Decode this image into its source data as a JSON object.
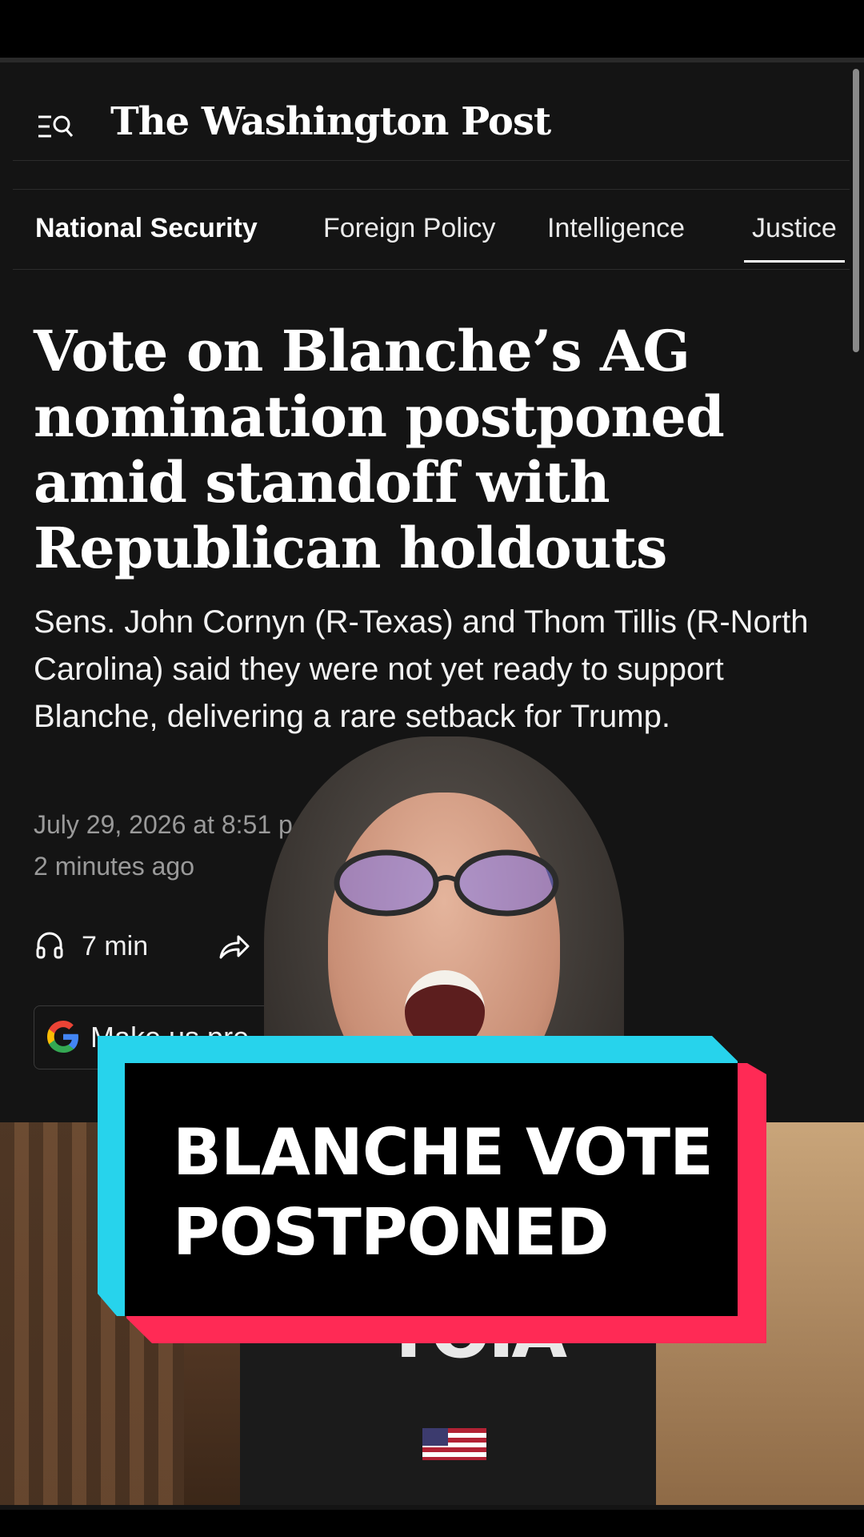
{
  "site": {
    "logo": "The Washington Post"
  },
  "nav_tabs": [
    {
      "label": "National Security",
      "active": true
    },
    {
      "label": "Foreign Policy",
      "active": false
    },
    {
      "label": "Intelligence",
      "active": false
    },
    {
      "label": "Justice",
      "active": false
    }
  ],
  "article": {
    "headline": "Vote on Blanche’s AG nomination postponed amid standoff with Republican holdouts",
    "dek": "Sens. John Cornyn (R-Texas) and Thom Tillis (R-North Carolina) said they were not yet ready to support Blanche, delivering a rare setback for Trump.",
    "timestamp_date": "July 29, 2026 at 8:51 p",
    "timestamp_relative": "2 minutes ago",
    "listen_duration": "7 min",
    "google_pill_text": "Make us pre"
  },
  "overlay": {
    "caption_line1": "BLANCHE VOTE",
    "caption_line2": "POSTPONED",
    "shirt_text": "TOIA"
  },
  "colors": {
    "background": "#141414",
    "caption_cyan": "#27d3ec",
    "caption_red": "#ff2a55",
    "caption_black": "#000000"
  },
  "icons": {
    "menu": "menu-search-icon",
    "listen": "headphones-icon",
    "share": "share-arrow-icon",
    "google": "google-g-icon"
  }
}
